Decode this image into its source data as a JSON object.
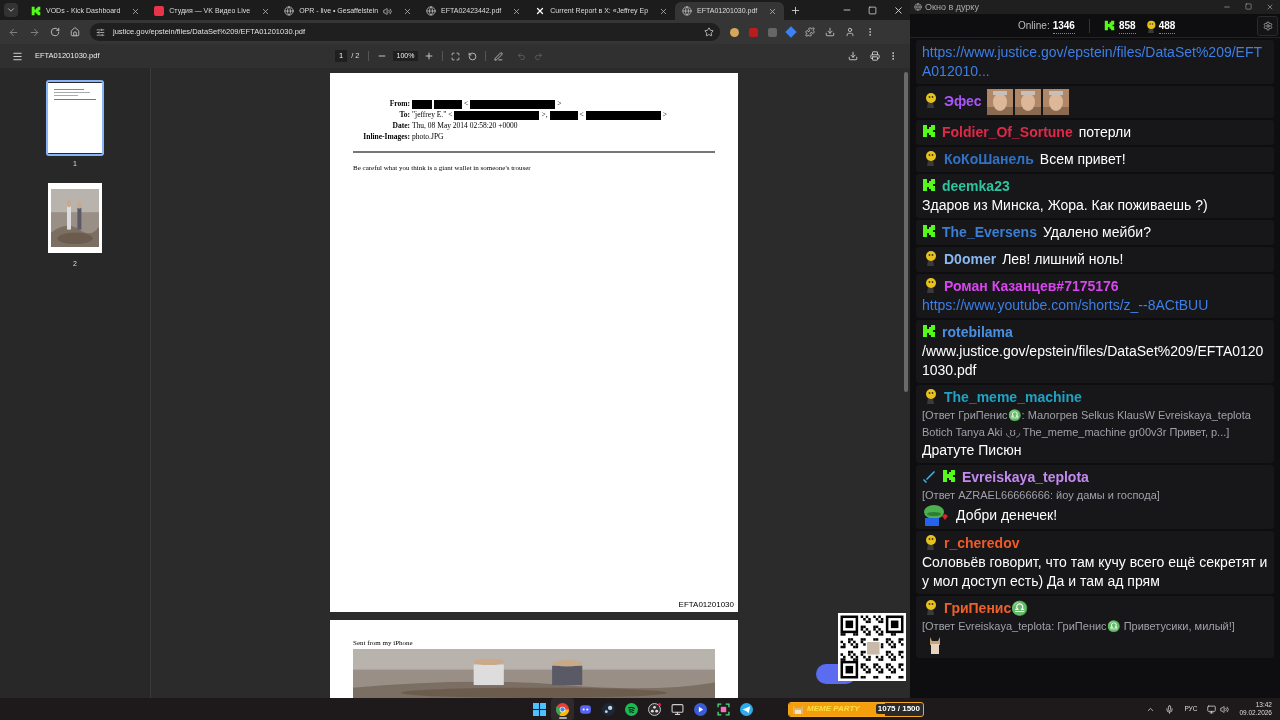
{
  "browser": {
    "tabs": [
      {
        "title": "VODs - Kick Dashboard",
        "kind": "kick",
        "audio": false,
        "selected": false
      },
      {
        "title": "Студия — VK Видео Live",
        "kind": "studio",
        "audio": false,
        "selected": false
      },
      {
        "title": "OPR - live • Gesaffelstein",
        "kind": "globe",
        "audio": true,
        "selected": false
      },
      {
        "title": "EFTA02423442.pdf",
        "kind": "globe",
        "audio": false,
        "selected": false
      },
      {
        "title": "Current Report в X: «Jeffrey Ep",
        "kind": "x",
        "audio": false,
        "selected": false
      },
      {
        "title": "EFTA01201030.pdf",
        "kind": "globe",
        "audio": false,
        "selected": true
      }
    ],
    "address": "justice.gov/epstein/files/DataSet%209/EFTA01201030.pdf"
  },
  "pdf_viewer": {
    "filename": "EFTA01201030.pdf",
    "page": "1",
    "page_total": "/ 2",
    "zoom": "100%",
    "thumbnails": [
      {
        "label": "1",
        "kind": "text",
        "selected": true
      },
      {
        "label": "2",
        "selected": false
      }
    ],
    "page_1": {
      "header": [
        {
          "label": "From:",
          "parts": [
            {
              "kind": "redaction"
            },
            {
              "kind": "redaction"
            },
            {
              "kind": "text",
              "text": "<"
            },
            {
              "kind": "redaction"
            },
            {
              "kind": "text",
              "text": ">"
            }
          ]
        },
        {
          "label": "To:",
          "parts": [
            {
              "kind": "text",
              "text": "\"jeffrey E.\" <"
            },
            {
              "kind": "redaction"
            },
            {
              "kind": "text",
              "text": ">,"
            },
            {
              "kind": "redaction"
            },
            {
              "kind": "text",
              "text": "<"
            },
            {
              "kind": "redaction"
            },
            {
              "kind": "text",
              "text": ">"
            }
          ]
        },
        {
          "label": "Date:",
          "parts": [
            {
              "kind": "text",
              "text": "Thu, 08 May 2014 02:58:20 +0000"
            }
          ]
        },
        {
          "label": "Inline-Images:",
          "parts": [
            {
              "kind": "text",
              "text": "photo.JPG"
            }
          ]
        }
      ],
      "body": "Be careful what you think is a giant wallet in someone's trouser",
      "footer": "EFTA01201030"
    },
    "page_2": {
      "caption": "Sent from my iPhone"
    }
  },
  "chat": {
    "title": "Окно в дурку",
    "online_label": "Online:",
    "online": "1346",
    "kick_count": "858",
    "other_count": "488",
    "messages": [
      {
        "text": "https://www.justice.gov/epstein/files/DataSet%209/EFTA012010...",
        "kind": "link"
      },
      {
        "badges": [
          {
            "kind": "smiley"
          }
        ],
        "user": "Эфес",
        "color": "#a855f7",
        "emotes": [
          {
            "kind": "picture"
          },
          {
            "kind": "picture"
          },
          {
            "kind": "picture"
          }
        ]
      },
      {
        "badges": [
          {
            "kind": "kick"
          }
        ],
        "user": "Foldier_Of_Sortune",
        "color": "#e0284a",
        "text": "потерли",
        "kind": "inline"
      },
      {
        "badges": [
          {
            "kind": "smiley"
          }
        ],
        "user": "КоКоШанель",
        "color": "#2f73c9",
        "text": "Всем привет!",
        "kind": "inline"
      },
      {
        "badges": [
          {
            "kind": "kick"
          }
        ],
        "user": "deemka23",
        "color": "#2ec4a0",
        "text": "Здаров из Минска, Жора. Как поживаешь ?)",
        "kind": "block"
      },
      {
        "badges": [
          {
            "kind": "kick"
          }
        ],
        "user": "The_Eversens",
        "color": "#3a7fd6",
        "text": "Удалено мейби?",
        "kind": "inline"
      },
      {
        "badges": [
          {
            "kind": "smiley"
          }
        ],
        "user": "D0omer",
        "color": "#8ab8f0",
        "text": "Лев! лишний ноль!",
        "kind": "inline"
      },
      {
        "badges": [
          {
            "kind": "smiley"
          }
        ],
        "user": "Роман Казанцев#7175176",
        "color": "#d946ef",
        "text": "https://www.youtube.com/shorts/z_--8ACtBUU",
        "kind": "link"
      },
      {
        "badges": [
          {
            "kind": "kick"
          }
        ],
        "user": "rotebilama",
        "color": "#4a90e2",
        "text": "/www.justice.gov/epstein/files/DataSet%209/EFTA01201030.pdf",
        "kind": "block"
      },
      {
        "badges": [
          {
            "kind": "smiley"
          }
        ],
        "user": "The_meme_machine",
        "color": "#1fa3c4",
        "reply": "[Ответ ГриПенис♎: Малогрев Selkus KlausW Evreiskaya_teplota Botich Tanya Aki ◟ʊ◞ The_meme_machine gr00v3r Привет, р...]",
        "text": "Дратуте Писюн",
        "kind": "block"
      },
      {
        "badges": [
          {
            "kind": "sword"
          },
          {
            "kind": "kick"
          }
        ],
        "user": "Evreiskaya_teplota",
        "color": "#c38af0",
        "reply": "[Ответ AZRAEL66666666: йоу дамы и господа]",
        "emotes": [
          {
            "kind": "frog"
          }
        ],
        "text": "Добри денечек!",
        "kind": "inline"
      },
      {
        "badges": [
          {
            "kind": "smiley"
          }
        ],
        "user": "r_cheredov",
        "color": "#f05a28",
        "text": "Соловьёв говорит, что там кучу всего ещё секретят и у мол доступ есть) Да и там ад прям",
        "kind": "block"
      },
      {
        "badges": [
          {
            "kind": "smiley"
          }
        ],
        "user": "ГриПенис♎",
        "color": "#f0602a",
        "reply": "[Ответ Evreiskaya_teplota: ГриПенис♎ Приветусики, милый!]",
        "emotes": [
          {
            "kind": "cat"
          }
        ]
      }
    ]
  },
  "taskbar": {
    "apps": [
      {
        "kind": "windows",
        "selected": false
      },
      {
        "kind": "browser",
        "selected": true
      },
      {
        "kind": "discord",
        "selected": false
      },
      {
        "kind": "steam",
        "selected": false
      },
      {
        "kind": "spotify",
        "selected": false
      },
      {
        "kind": "recorder",
        "selected": false
      },
      {
        "kind": "monitor",
        "selected": false
      },
      {
        "kind": "player",
        "selected": false
      },
      {
        "kind": "snip",
        "selected": false
      },
      {
        "kind": "telegram",
        "selected": false
      }
    ],
    "widget": {
      "title": "MEME PARTY",
      "reading": "1075 / 1500",
      "level": 0.72
    },
    "language": "РУС",
    "time": "13:42",
    "date": "09.02.2026"
  }
}
